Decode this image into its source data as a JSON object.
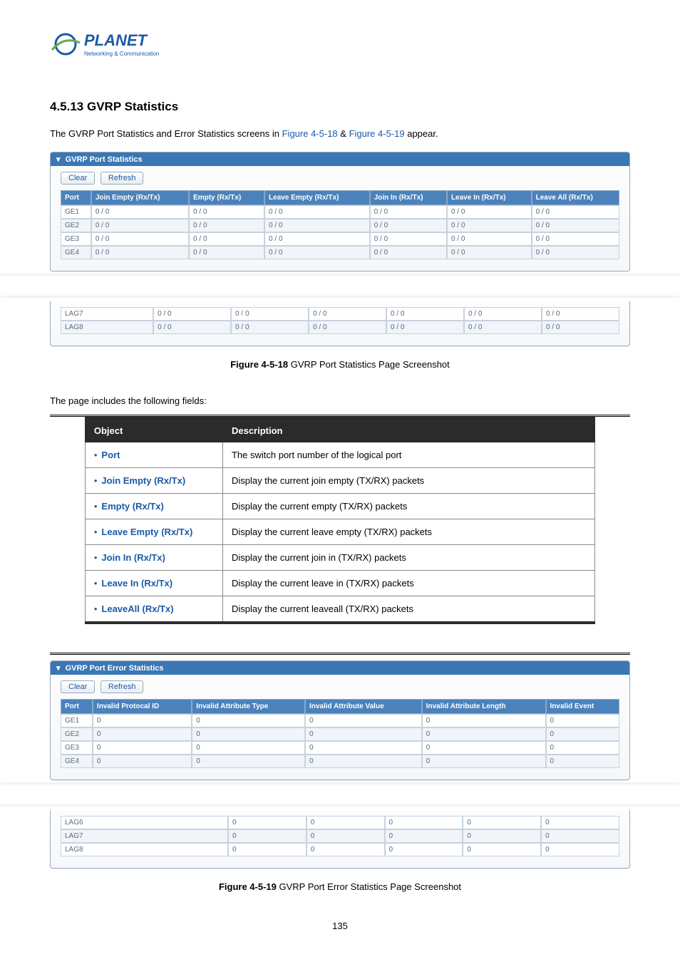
{
  "logo": {
    "brand": "PLANET",
    "tagline": "Networking & Communication"
  },
  "section_title": "4.5.13 GVRP Statistics",
  "intro_pre": "The GVRP Port Statistics and Error Statistics screens in ",
  "intro_link1": "Figure 4-5-18",
  "intro_amp": " & ",
  "intro_link2": "Figure 4-5-19",
  "intro_post": " appear.",
  "panel1": {
    "title": "GVRP Port Statistics",
    "btn_clear": "Clear",
    "btn_refresh": "Refresh",
    "cols": [
      "Port",
      "Join Empty (Rx/Tx)",
      "Empty (Rx/Tx)",
      "Leave Empty (Rx/Tx)",
      "Join In (Rx/Tx)",
      "Leave In (Rx/Tx)",
      "Leave All (Rx/Tx)"
    ],
    "rows_top": [
      [
        "GE1",
        "0 / 0",
        "0 / 0",
        "0 / 0",
        "0 / 0",
        "0 / 0",
        "0 / 0"
      ],
      [
        "GE2",
        "0 / 0",
        "0 / 0",
        "0 / 0",
        "0 / 0",
        "0 / 0",
        "0 / 0"
      ],
      [
        "GE3",
        "0 / 0",
        "0 / 0",
        "0 / 0",
        "0 / 0",
        "0 / 0",
        "0 / 0"
      ],
      [
        "GE4",
        "0 / 0",
        "0 / 0",
        "0 / 0",
        "0 / 0",
        "0 / 0",
        "0 / 0"
      ]
    ],
    "rows_bottom": [
      [
        "LAG7",
        "0 / 0",
        "0 / 0",
        "0 / 0",
        "0 / 0",
        "0 / 0",
        "0 / 0"
      ],
      [
        "LAG8",
        "0 / 0",
        "0 / 0",
        "0 / 0",
        "0 / 0",
        "0 / 0",
        "0 / 0"
      ]
    ]
  },
  "caption1_b": "Figure 4-5-18",
  "caption1_t": " GVRP Port Statistics Page Screenshot",
  "fields_intro": "The page includes the following fields:",
  "obj_header": {
    "c1": "Object",
    "c2": "Description"
  },
  "obj_rows": [
    {
      "name": "Port",
      "desc": "The switch port number of the logical port"
    },
    {
      "name": "Join Empty (Rx/Tx)",
      "desc": "Display the current join empty (TX/RX) packets"
    },
    {
      "name": "Empty (Rx/Tx)",
      "desc": "Display the current empty (TX/RX) packets"
    },
    {
      "name": "Leave Empty (Rx/Tx)",
      "desc": "Display the current leave empty (TX/RX) packets"
    },
    {
      "name": "Join In (Rx/Tx)",
      "desc": "Display the current join in (TX/RX) packets"
    },
    {
      "name": "Leave In (Rx/Tx)",
      "desc": "Display the current leave in (TX/RX) packets"
    },
    {
      "name": "LeaveAll (Rx/Tx)",
      "desc": "Display the current leaveall (TX/RX) packets"
    }
  ],
  "panel2": {
    "title": "GVRP Port Error Statistics",
    "btn_clear": "Clear",
    "btn_refresh": "Refresh",
    "cols": [
      "Port",
      "Invalid Protocal ID",
      "Invalid Attribute Type",
      "Invalid Attribute Value",
      "Invalid Attribute Length",
      "Invalid Event"
    ],
    "rows_top": [
      [
        "GE1",
        "0",
        "0",
        "0",
        "0",
        "0"
      ],
      [
        "GE2",
        "0",
        "0",
        "0",
        "0",
        "0"
      ],
      [
        "GE3",
        "0",
        "0",
        "0",
        "0",
        "0"
      ],
      [
        "GE4",
        "0",
        "0",
        "0",
        "0",
        "0"
      ]
    ],
    "rows_bottom": [
      [
        "LAG6",
        "0",
        "0",
        "0",
        "0",
        "0"
      ],
      [
        "LAG7",
        "0",
        "0",
        "0",
        "0",
        "0"
      ],
      [
        "LAG8",
        "0",
        "0",
        "0",
        "0",
        "0"
      ]
    ]
  },
  "caption2_b": "Figure 4-5-19",
  "caption2_t": " GVRP Port Error Statistics Page Screenshot",
  "page_num": "135"
}
